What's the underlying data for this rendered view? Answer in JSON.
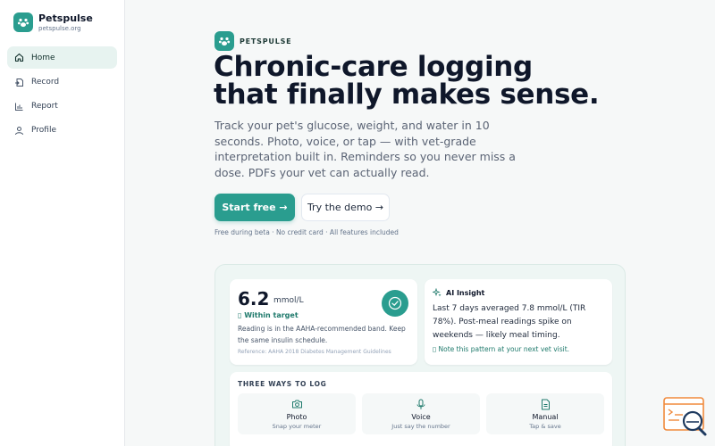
{
  "brand": {
    "name": "Petspulse",
    "url": "petspulse.org",
    "color": "#2a9d8f"
  },
  "nav": {
    "items": [
      {
        "label": "Home",
        "icon": "home-icon",
        "active": true
      },
      {
        "label": "Record",
        "icon": "record-icon"
      },
      {
        "label": "Report",
        "icon": "chart-icon"
      },
      {
        "label": "Profile",
        "icon": "user-icon"
      }
    ]
  },
  "hero": {
    "eyebrow": "PETSPULSE",
    "title_line1": "Chronic-care logging",
    "title_line2": "that finally makes sense.",
    "subtitle": "Track your pet's glucose, weight, and water in 10 seconds. Photo, voice, or tap — with vet-grade interpretation built in. Reminders so you never miss a dose. PDFs your vet can actually read.",
    "primary_cta": "Start free →",
    "secondary_cta": "Try the demo →",
    "fine_print": "Free during beta · No credit card · All features included"
  },
  "reading_card": {
    "value": "6.2",
    "unit": "mmol/L",
    "status": "▯ Within target",
    "description": "Reading is in the AAHA-recommended band. Keep the same insulin schedule.",
    "reference": "Reference: AAHA 2018 Diabetes Management Guidelines"
  },
  "insight_card": {
    "title": "AI Insight",
    "body": "Last 7 days averaged 7.8 mmol/L (TIR 78%). Post-meal readings spike on weekends — likely meal timing.",
    "note": "▯ Note this pattern at your next vet visit."
  },
  "ways": {
    "title": "THREE WAYS TO LOG",
    "items": [
      {
        "label": "Photo",
        "hint": "Snap your meter",
        "icon": "camera-icon"
      },
      {
        "label": "Voice",
        "hint": "Just say the number",
        "icon": "microphone-icon"
      },
      {
        "label": "Manual",
        "hint": "Tap & save",
        "icon": "document-icon"
      }
    ]
  }
}
